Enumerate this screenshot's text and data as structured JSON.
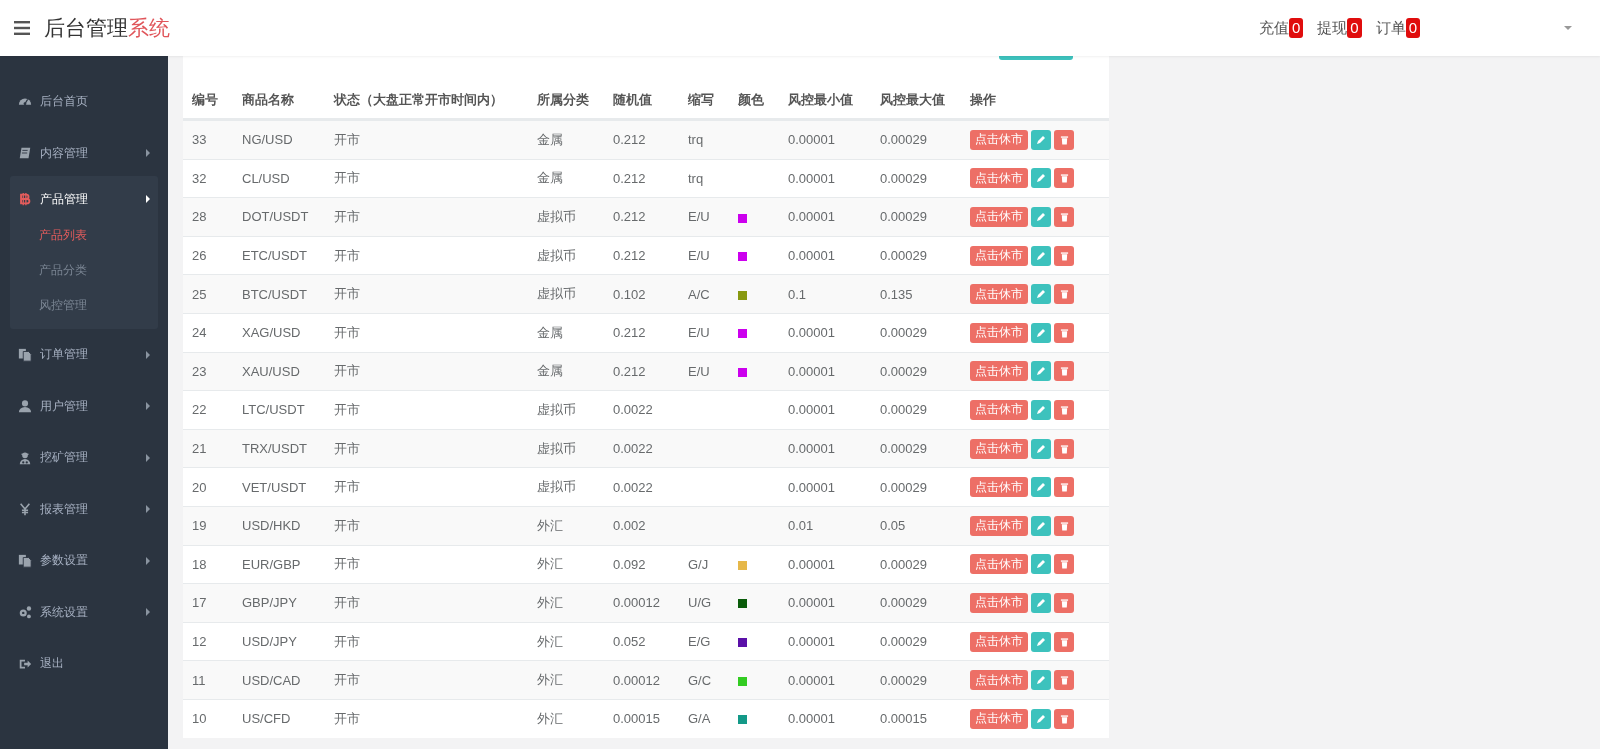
{
  "header": {
    "title": "后台管理",
    "title_accent": "系统",
    "counters": [
      {
        "label": "充值",
        "count": "0"
      },
      {
        "label": "提现",
        "count": "0"
      },
      {
        "label": "订单",
        "count": "0"
      }
    ]
  },
  "sidebar": {
    "items": [
      {
        "label": "后台首页",
        "kind": "link"
      },
      {
        "label": "内容管理",
        "kind": "menu",
        "expanded": false
      },
      {
        "label": "产品管理",
        "kind": "menu",
        "expanded": true,
        "children": [
          {
            "label": "产品列表",
            "selected": true
          },
          {
            "label": "产品分类",
            "selected": false
          },
          {
            "label": "风控管理",
            "selected": false
          }
        ]
      },
      {
        "label": "订单管理",
        "kind": "menu",
        "expanded": false
      },
      {
        "label": "用户管理",
        "kind": "menu",
        "expanded": false
      },
      {
        "label": "挖矿管理",
        "kind": "menu",
        "expanded": false
      },
      {
        "label": "报表管理",
        "kind": "menu",
        "expanded": false
      },
      {
        "label": "参数设置",
        "kind": "menu",
        "expanded": false
      },
      {
        "label": "系统设置",
        "kind": "menu",
        "expanded": false
      },
      {
        "label": "退出",
        "kind": "link"
      }
    ]
  },
  "table": {
    "columns": [
      "编号",
      "商品名称",
      "状态（大盘正常开市时间内）",
      "所属分类",
      "随机值",
      "缩写",
      "颜色",
      "风控最小值",
      "风控最大值",
      "操作"
    ],
    "rows": [
      {
        "id": "33",
        "name": "NG/USD",
        "status": "开市",
        "category": "金属",
        "random": "0.212",
        "abbr": "trq",
        "min": "0.00001",
        "max": "0.00029",
        "action": "点击休市"
      },
      {
        "id": "32",
        "name": "CL/USD",
        "status": "开市",
        "category": "金属",
        "random": "0.212",
        "abbr": "trq",
        "min": "0.00001",
        "max": "0.00029",
        "action": "点击休市"
      },
      {
        "id": "28",
        "name": "DOT/USDT",
        "status": "开市",
        "category": "虚拟币",
        "random": "0.212",
        "abbr": "E/U",
        "color": "#cc00ee",
        "min": "0.00001",
        "max": "0.00029",
        "action": "点击休市"
      },
      {
        "id": "26",
        "name": "ETC/USDT",
        "status": "开市",
        "category": "虚拟币",
        "random": "0.212",
        "abbr": "E/U",
        "color": "#cc00ee",
        "min": "0.00001",
        "max": "0.00029",
        "action": "点击休市"
      },
      {
        "id": "25",
        "name": "BTC/USDT",
        "status": "开市",
        "category": "虚拟币",
        "random": "0.102",
        "abbr": "A/C",
        "color": "#889911",
        "min": "0.1",
        "max": "0.135",
        "action": "点击休市"
      },
      {
        "id": "24",
        "name": "XAG/USD",
        "status": "开市",
        "category": "金属",
        "random": "0.212",
        "abbr": "E/U",
        "color": "#cc00ee",
        "min": "0.00001",
        "max": "0.00029",
        "action": "点击休市"
      },
      {
        "id": "23",
        "name": "XAU/USD",
        "status": "开市",
        "category": "金属",
        "random": "0.212",
        "abbr": "E/U",
        "color": "#cc00ee",
        "min": "0.00001",
        "max": "0.00029",
        "action": "点击休市"
      },
      {
        "id": "22",
        "name": "LTC/USDT",
        "status": "开市",
        "category": "虚拟币",
        "random": "0.0022",
        "min": "0.00001",
        "max": "0.00029",
        "action": "点击休市"
      },
      {
        "id": "21",
        "name": "TRX/USDT",
        "status": "开市",
        "category": "虚拟币",
        "random": "0.0022",
        "min": "0.00001",
        "max": "0.00029",
        "action": "点击休市"
      },
      {
        "id": "20",
        "name": "VET/USDT",
        "status": "开市",
        "category": "虚拟币",
        "random": "0.0022",
        "min": "0.00001",
        "max": "0.00029",
        "action": "点击休市"
      },
      {
        "id": "19",
        "name": "USD/HKD",
        "status": "开市",
        "category": "外汇",
        "random": "0.002",
        "min": "0.01",
        "max": "0.05",
        "action": "点击休市"
      },
      {
        "id": "18",
        "name": "EUR/GBP",
        "status": "开市",
        "category": "外汇",
        "random": "0.092",
        "abbr": "G/J",
        "color": "#e6b84a",
        "min": "0.00001",
        "max": "0.00029",
        "action": "点击休市"
      },
      {
        "id": "17",
        "name": "GBP/JPY",
        "status": "开市",
        "category": "外汇",
        "random": "0.00012",
        "abbr": "U/G",
        "color": "#0a5c0a",
        "min": "0.00001",
        "max": "0.00029",
        "action": "点击休市"
      },
      {
        "id": "12",
        "name": "USD/JPY",
        "status": "开市",
        "category": "外汇",
        "random": "0.052",
        "abbr": "E/G",
        "color": "#5a10a8",
        "min": "0.00001",
        "max": "0.00029",
        "action": "点击休市"
      },
      {
        "id": "11",
        "name": "USD/CAD",
        "status": "开市",
        "category": "外汇",
        "random": "0.00012",
        "abbr": "G/C",
        "color": "#33cc22",
        "min": "0.00001",
        "max": "0.00029",
        "action": "点击休市"
      },
      {
        "id": "10",
        "name": "US/CFD",
        "status": "开市",
        "category": "外汇",
        "random": "0.00015",
        "abbr": "G/A",
        "color": "#139988",
        "min": "0.00001",
        "max": "0.00015",
        "action": "点击休市"
      }
    ]
  }
}
